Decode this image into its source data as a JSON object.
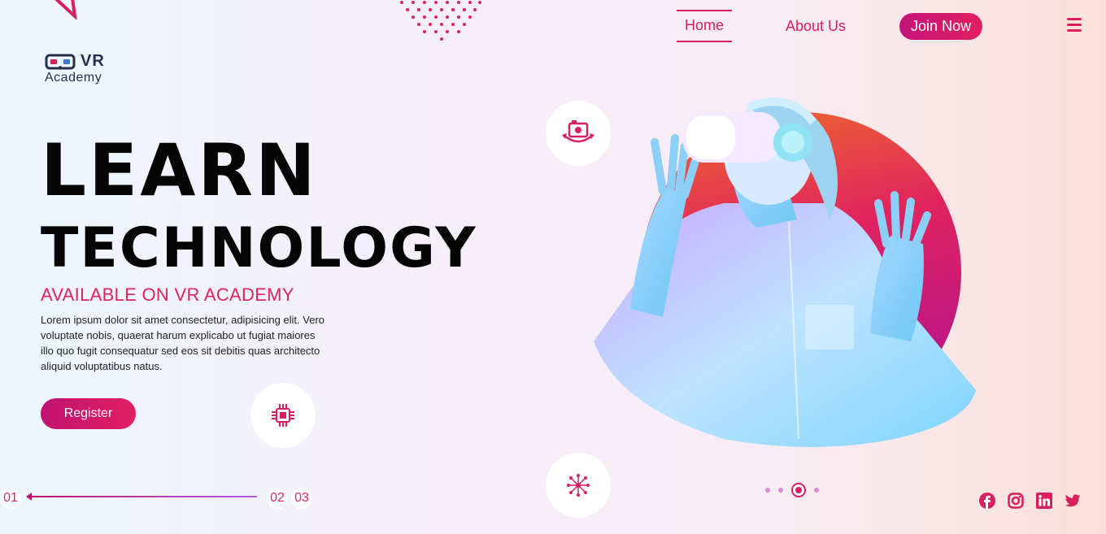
{
  "brand": {
    "logo_line1": "VR",
    "logo_line2": "Academy"
  },
  "nav": {
    "home": "Home",
    "about": "About Us",
    "join": "Join Now"
  },
  "hero": {
    "headline1": "LEARN",
    "headline2": "TECHNOLOGY",
    "subheading": "AVAILABLE ON VR ACADEMY",
    "paragraph": "Lorem ipsum dolor sit amet consectetur, adipisicing elit. Vero voluptate nobis, quaerat harum explicabo ut fugiat maiores illo quo fugit consequatur sed eos sit debitis quas architecto aliquid voluptatibus natus.",
    "register_label": "Register"
  },
  "slider": {
    "current": "01",
    "second": "02",
    "third": "03"
  },
  "pager": {
    "count": 4,
    "active_index": 2
  },
  "social": [
    "facebook-icon",
    "instagram-icon",
    "linkedin-icon",
    "twitter-icon"
  ],
  "colors": {
    "accent": "#e0245e",
    "accent_dark": "#c0136f",
    "text": "#050505"
  }
}
